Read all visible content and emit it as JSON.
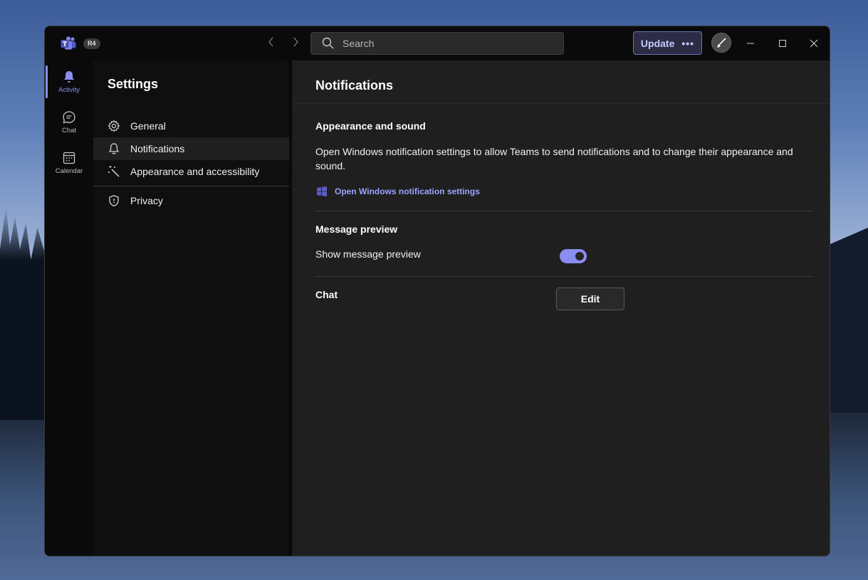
{
  "titlebar": {
    "badge": "R4",
    "search_placeholder": "Search",
    "update_label": "Update",
    "update_more": "•••"
  },
  "rail": {
    "items": [
      {
        "label": "Activity",
        "icon": "bell-icon",
        "active": true
      },
      {
        "label": "Chat",
        "icon": "chat-icon",
        "active": false
      },
      {
        "label": "Calendar",
        "icon": "calendar-icon",
        "active": false
      }
    ]
  },
  "sidebar": {
    "title": "Settings",
    "items": [
      {
        "label": "General",
        "icon": "gear-icon",
        "selected": false
      },
      {
        "label": "Notifications",
        "icon": "bell-icon",
        "selected": true
      },
      {
        "label": "Appearance and accessibility",
        "icon": "magic-wand-icon",
        "selected": false
      },
      {
        "label": "Privacy",
        "icon": "shield-icon",
        "selected": false
      }
    ]
  },
  "main": {
    "title": "Notifications",
    "appearance": {
      "title": "Appearance and sound",
      "description": "Open Windows notification settings to allow Teams to send notifications and to change their appearance and sound.",
      "link_label": "Open Windows notification settings"
    },
    "message_preview": {
      "title": "Message preview",
      "label": "Show message preview",
      "enabled": true
    },
    "chat": {
      "title": "Chat",
      "button_label": "Edit"
    }
  },
  "colors": {
    "accent": "#8b8df0",
    "link": "#9ea2ff",
    "background": "#1f1f1f",
    "sidebar": "#0f0f0f",
    "titlebar": "#0a0a0a"
  }
}
